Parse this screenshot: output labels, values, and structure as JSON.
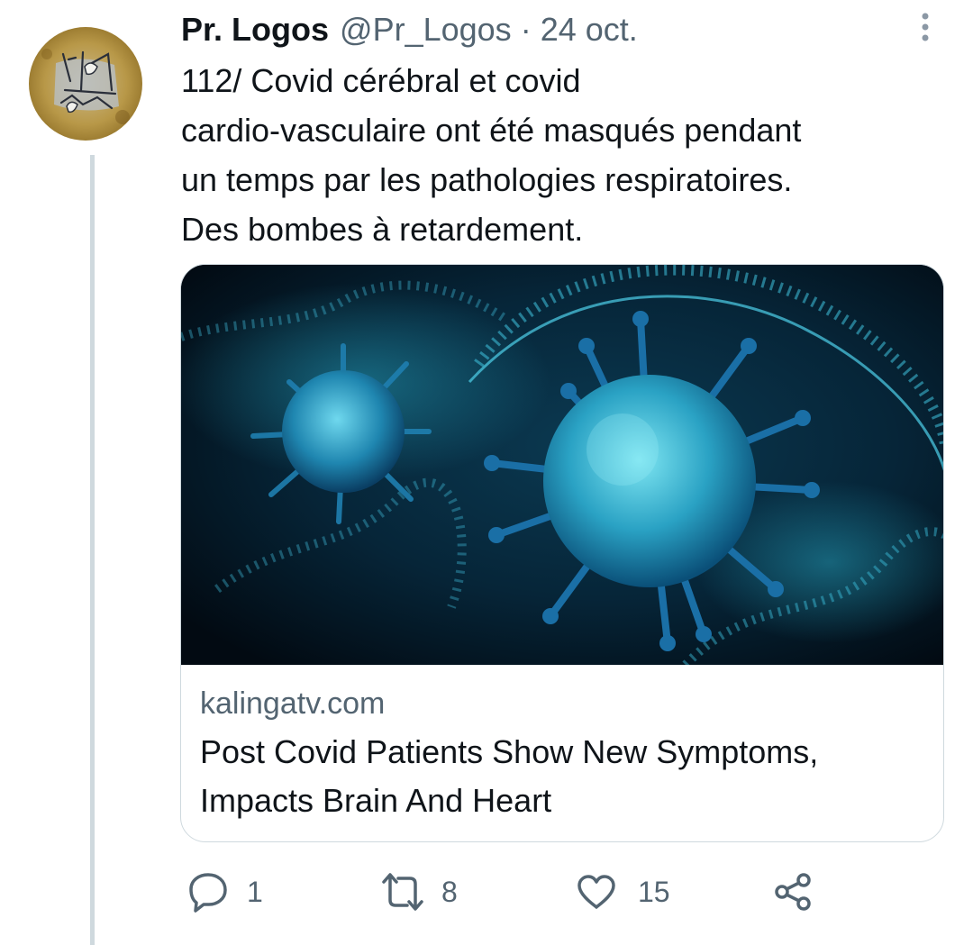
{
  "tweet": {
    "display_name": "Pr. Logos",
    "handle": "@Pr_Logos",
    "separator": "·",
    "date": "24 oct.",
    "text": "112/ Covid cérébral et covid\ncardio-vasculaire ont été masqués pendant\nun temps par les pathologies respiratoires.\nDes bombes à retardement."
  },
  "card": {
    "domain": "kalingatv.com",
    "title": "Post Covid Patients Show New Symptoms, Impacts Brain And Heart"
  },
  "actions": {
    "reply_count": "1",
    "retweet_count": "8",
    "like_count": "15"
  },
  "icons": {
    "reply": "reply-icon",
    "retweet": "retweet-icon",
    "like": "heart-icon",
    "share": "share-icon",
    "more": "more-vertical-icon"
  },
  "colors": {
    "text_primary": "#0f1419",
    "text_secondary": "#536471",
    "border": "#cfd9de"
  }
}
